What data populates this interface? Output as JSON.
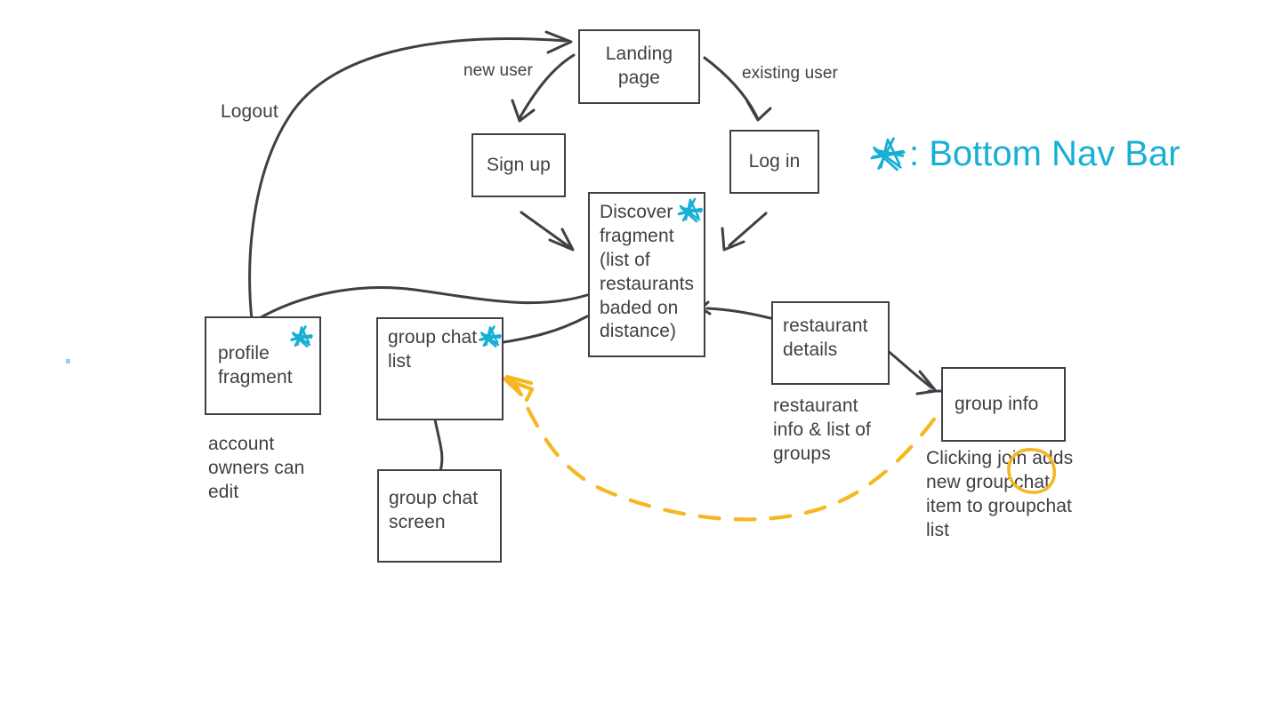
{
  "diagram": {
    "title": "App navigation flow diagram",
    "colors": {
      "stroke": "#3f3f46",
      "text": "#3f3f46",
      "accent_cyan": "#17b0d4",
      "accent_yellow": "#f5b722",
      "background": "#ffffff"
    },
    "nodes": [
      {
        "id": "landing",
        "label": "Landing\npage",
        "starred": false
      },
      {
        "id": "signup",
        "label": "Sign up",
        "starred": false
      },
      {
        "id": "login",
        "label": "Log in",
        "starred": false
      },
      {
        "id": "discover",
        "label": "Discover\nfragment\n(list of\nrestaurants\nbaded on\ndistance)",
        "starred": true
      },
      {
        "id": "profile",
        "label": "profile\nfragment",
        "starred": true
      },
      {
        "id": "groupchatlist",
        "label": "group chat\nlist",
        "starred": true
      },
      {
        "id": "groupchatscreen",
        "label": "group chat\nscreen",
        "starred": false
      },
      {
        "id": "restaurant",
        "label": "restaurant\ndetails",
        "starred": false
      },
      {
        "id": "groupinfo",
        "label": "group info",
        "starred": false
      }
    ],
    "edge_labels": [
      {
        "id": "new-user",
        "text": "new user"
      },
      {
        "id": "existing-user",
        "text": "existing user"
      },
      {
        "id": "logout",
        "text": "Logout"
      }
    ],
    "annotations": [
      {
        "id": "profile-note",
        "text": "account\nowners can\nedit"
      },
      {
        "id": "restaurant-note",
        "text": "restaurant\ninfo & list of\ngroups"
      },
      {
        "id": "join-note",
        "text": "Clicking join adds\nnew groupchat\nitem to groupchat\nlist"
      }
    ],
    "legend": {
      "symbol": "star-icon",
      "text": "☆ : Bottom Nav Bar"
    }
  }
}
